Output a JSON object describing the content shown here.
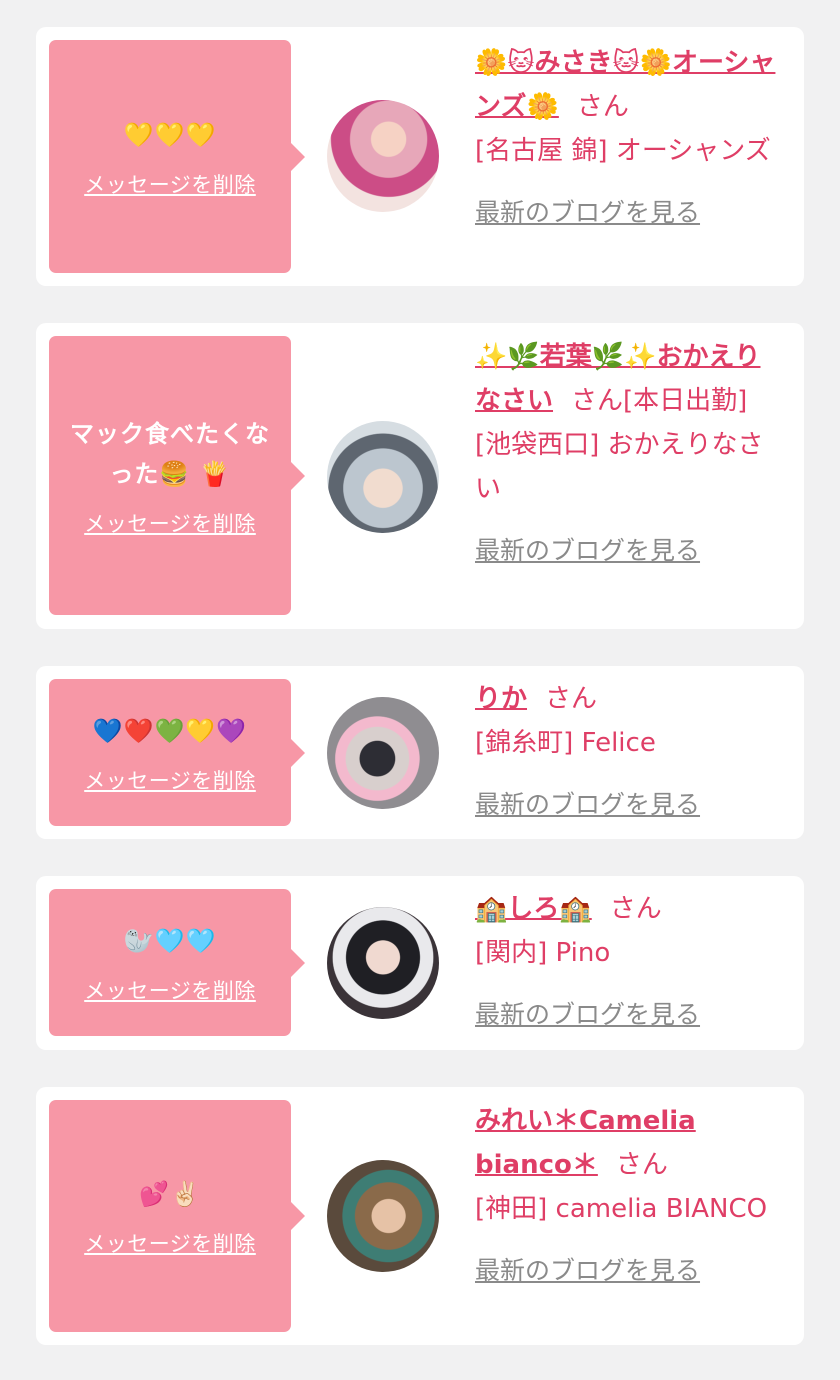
{
  "cards": [
    {
      "message": "💛💛💛",
      "delete_label": "メッセージを削除",
      "name": "🌼🐱みさき🐱🌼オーシャンズ🌼",
      "san": "さん",
      "shop": "[名古屋 錦] オーシャンズ",
      "blog_label": "最新のブログを見る"
    },
    {
      "message": "マック食べたくなった🍔 🍟",
      "delete_label": "メッセージを削除",
      "name": "✨🌿若葉🌿✨おかえりなさい",
      "san": "さん[本日出勤]",
      "shop": "[池袋西口] おかえりなさい",
      "blog_label": "最新のブログを見る"
    },
    {
      "message": "💙❤️💚💛💜",
      "delete_label": "メッセージを削除",
      "name": "りか",
      "san": "さん",
      "shop": "[錦糸町] Felice",
      "blog_label": "最新のブログを見る"
    },
    {
      "message": "🦭🩵🩵",
      "delete_label": "メッセージを削除",
      "name": "🏫しろ🏫",
      "san": "さん",
      "shop": "[関内] Pino",
      "blog_label": "最新のブログを見る"
    },
    {
      "message": "💕✌🏻",
      "delete_label": "メッセージを削除",
      "name": "みれい＊Camelia bianco＊",
      "san": "さん",
      "shop": "[神田] camelia BIANCO",
      "blog_label": "最新のブログを見る"
    }
  ],
  "colors": {
    "accent": "#df3e66",
    "bubble": "#f797a6",
    "link_gray": "#8a8a8a",
    "background": "#f1f1f2"
  }
}
